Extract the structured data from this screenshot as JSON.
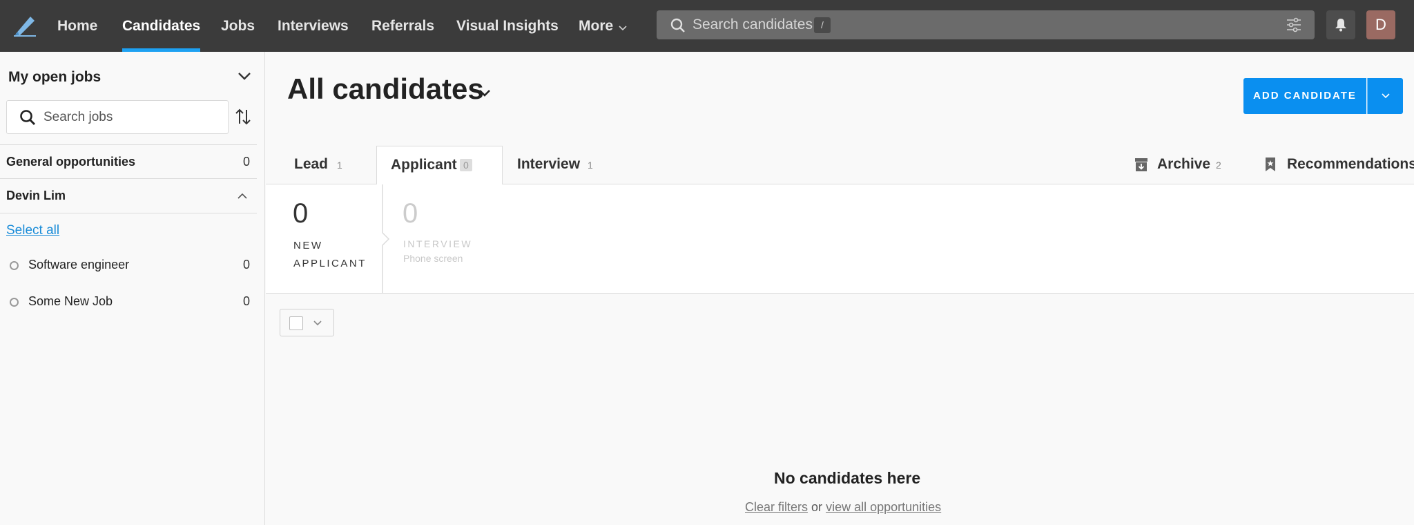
{
  "nav": {
    "items": [
      {
        "label": "Home",
        "active": false
      },
      {
        "label": "Candidates",
        "active": true
      },
      {
        "label": "Jobs",
        "active": false
      },
      {
        "label": "Interviews",
        "active": false
      },
      {
        "label": "Referrals",
        "active": false
      },
      {
        "label": "Visual Insights",
        "active": false
      },
      {
        "label": "More",
        "active": false
      }
    ],
    "search_placeholder": "Search candidates",
    "search_shortcut": "/",
    "avatar_initial": "D",
    "accent_color": "#1da1f2"
  },
  "sidebar": {
    "title": "My open jobs",
    "search_placeholder": "Search jobs",
    "groups": [
      {
        "label": "General opportunities",
        "count": "0"
      },
      {
        "label": "Devin Lim",
        "expanded": true
      }
    ],
    "select_all": "Select all",
    "jobs": [
      {
        "label": "Software engineer",
        "count": "0"
      },
      {
        "label": "Some New Job",
        "count": "0"
      }
    ]
  },
  "main": {
    "title": "All candidates",
    "add_button": "ADD CANDIDATE",
    "tabs": [
      {
        "label": "Lead",
        "count": "1"
      },
      {
        "label": "Applicant",
        "count": "0",
        "active": true
      },
      {
        "label": "Interview",
        "count": "1"
      }
    ],
    "archive": {
      "label": "Archive",
      "count": "2"
    },
    "recommendations": {
      "label": "Recommendations"
    },
    "stages": [
      {
        "count": "0",
        "name_line1": "NEW",
        "name_line2": "APPLICANT"
      },
      {
        "count": "0",
        "name": "INTERVIEW",
        "sub": "Phone screen"
      }
    ],
    "empty": {
      "title": "No candidates here",
      "link1": "Clear filters",
      "connector": "or",
      "link2": "view all opportunities"
    }
  }
}
